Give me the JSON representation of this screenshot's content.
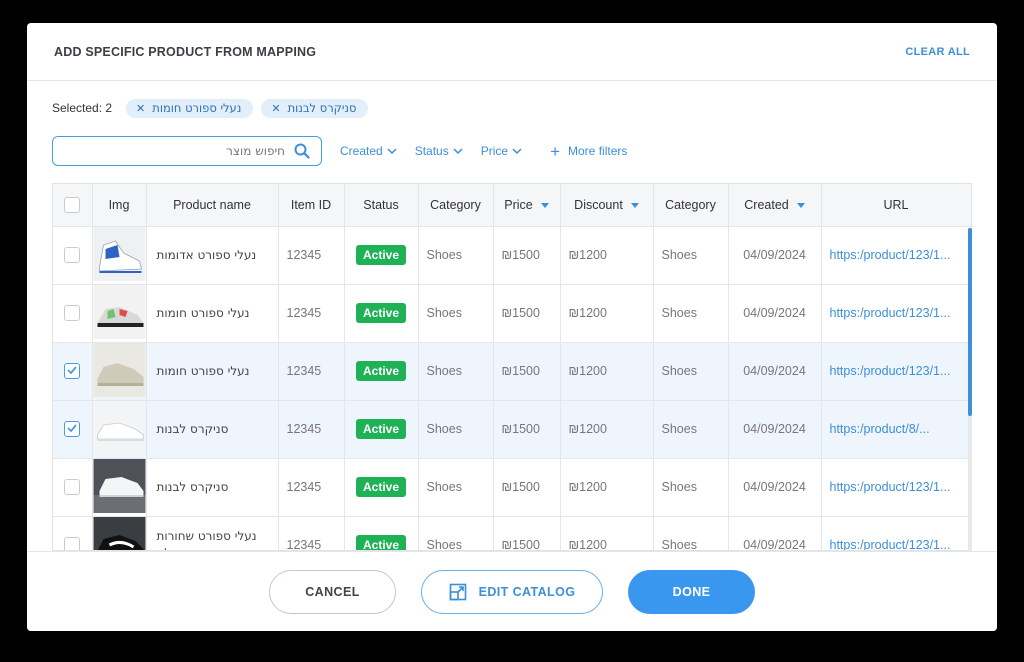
{
  "modal": {
    "title": "ADD SPECIFIC PRODUCT FROM MAPPING",
    "clear_all": "CLEAR ALL"
  },
  "selection": {
    "label": "Selected: 2",
    "chips": [
      {
        "label": "נעלי ספורט חומות"
      },
      {
        "label": "סניקרס לבנות"
      }
    ]
  },
  "search": {
    "placeholder": "חיפוש מוצר"
  },
  "filters": [
    "Created",
    "Status",
    "Price"
  ],
  "more_filters": "More filters",
  "table": {
    "columns": [
      "Img",
      "Product name",
      "Item ID",
      "Status",
      "Category",
      "Price",
      "Discount",
      "Category",
      "Created",
      "URL"
    ],
    "rows": [
      {
        "checked": false,
        "name": "נעלי ספורט אדומות",
        "item_id": "12345",
        "status": "Active",
        "category": "Shoes",
        "price": "₪1500",
        "discount": "₪1200",
        "category2": "Shoes",
        "created": "04/09/2024",
        "url": "https:/product/123/1...",
        "image": "blue-white-high-top-sneaker"
      },
      {
        "checked": false,
        "name": "נעלי ספורט חומות",
        "item_id": "12345",
        "status": "Active",
        "category": "Shoes",
        "price": "₪1500",
        "discount": "₪1200",
        "category2": "Shoes",
        "created": "04/09/2024",
        "url": "https:/product/123/1...",
        "image": "multicolor-runner-sneaker"
      },
      {
        "checked": true,
        "name": "נעלי ספורט חומות",
        "item_id": "12345",
        "status": "Active",
        "category": "Shoes",
        "price": "₪1500",
        "discount": "₪1200",
        "category2": "Shoes",
        "created": "04/09/2024",
        "url": "https:/product/123/1...",
        "image": "beige-sneaker"
      },
      {
        "checked": true,
        "name": "סניקרס לבנות",
        "item_id": "12345",
        "status": "Active",
        "category": "Shoes",
        "price": "₪1500",
        "discount": "₪1200",
        "category2": "Shoes",
        "created": "04/09/2024",
        "url": "https:/product/8/...",
        "image": "white-sneaker"
      },
      {
        "checked": false,
        "name": "סניקרס לבנות",
        "item_id": "12345",
        "status": "Active",
        "category": "Shoes",
        "price": "₪1500",
        "discount": "₪1200",
        "category2": "Shoes",
        "created": "04/09/2024",
        "url": "https:/product/123/1...",
        "image": "white-sneaker-on-rock"
      },
      {
        "checked": false,
        "name": "נעלי ספורט שחורות במהדורה מוגבלת",
        "item_id": "12345",
        "status": "Active",
        "category": "Shoes",
        "price": "₪1500",
        "discount": "₪1200",
        "category2": "Shoes",
        "created": "04/09/2024",
        "url": "https:/product/123/1...",
        "image": "black-white-sneaker"
      }
    ]
  },
  "footer": {
    "cancel": "CANCEL",
    "edit_catalog": "EDIT CATALOG",
    "done": "DONE"
  },
  "colors": {
    "accent": "#3d8fd8",
    "active_badge": "#1fb156",
    "selected_row": "#eef5fd",
    "done_button": "#3a97f0"
  },
  "icons": [
    "search-icon",
    "chevron-down-icon",
    "plus-icon",
    "close-icon",
    "checkbox-icon",
    "sort-icon",
    "external-link-icon"
  ]
}
